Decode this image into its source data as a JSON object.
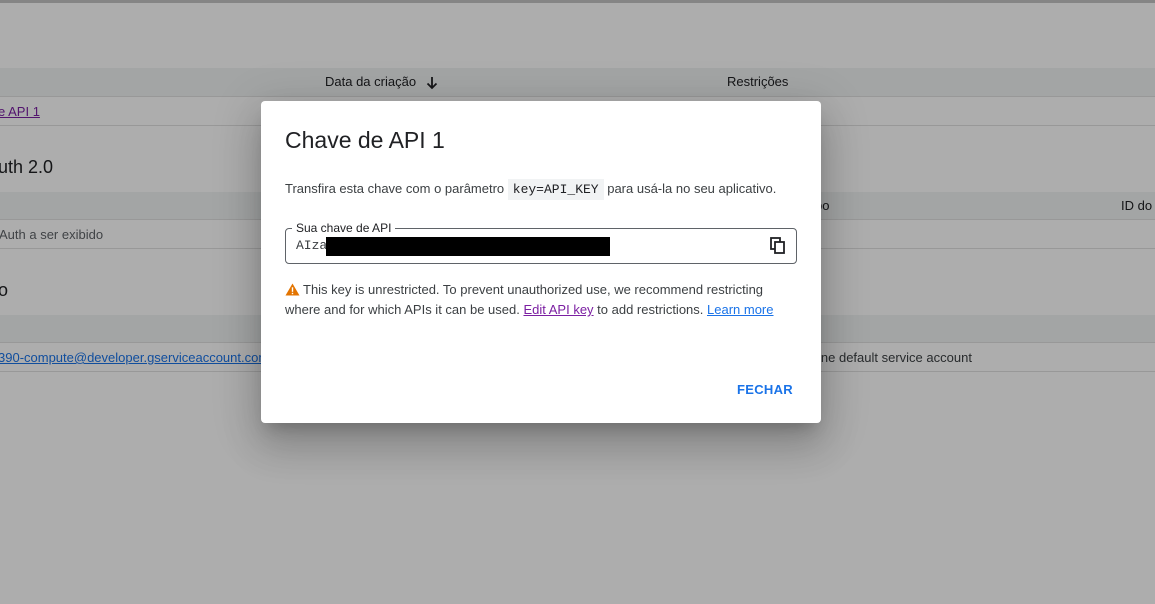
{
  "background": {
    "api_keys_table": {
      "col_name_partial": "",
      "col_created": "Data da criação",
      "col_restrictions": "Restrições",
      "row_link": "e API 1"
    },
    "oauth_section": {
      "title": "uth 2.0",
      "col_type_partial": "po",
      "col_id_partial": "ID do c",
      "empty_text": "Auth a ser exibido"
    },
    "service_section": {
      "title": "o",
      "row_email": "390-compute@developer.gserviceaccount.com",
      "row_desc": "ine default service account"
    }
  },
  "dialog": {
    "title": "Chave de API 1",
    "desc_before": "Transfira esta chave com o parâmetro ",
    "desc_code": "key=API_KEY",
    "desc_after": " para usá-la no seu aplicativo.",
    "field_label": "Sua chave de API",
    "field_value": "AIza",
    "warning_text": "This key is unrestricted. To prevent unauthorized use, we recommend restricting where and for which APIs it can be used. ",
    "edit_link": "Edit API key",
    "warning_after": " to add restrictions. ",
    "learn_link": "Learn more",
    "close_label": "FECHAR"
  },
  "colors": {
    "accent": "#1a73e8",
    "visited_link": "#7b1fa2",
    "warning": "#e37400"
  }
}
